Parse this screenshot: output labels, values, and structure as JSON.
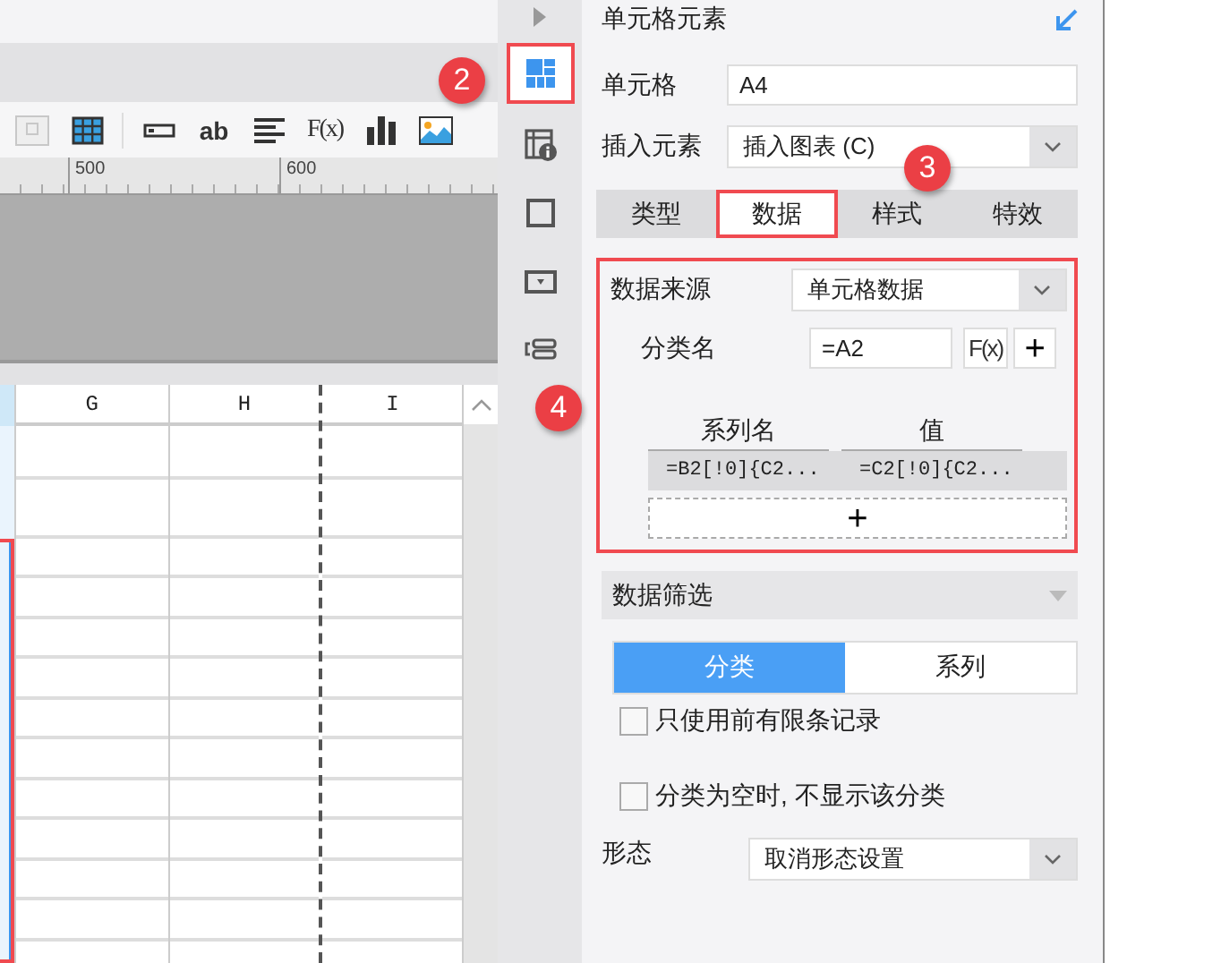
{
  "toolbar": {
    "tools": [
      {
        "kind": "frame",
        "disabled": true
      },
      {
        "kind": "table",
        "disabled": false
      },
      {
        "kind": "textfield",
        "disabled": false
      },
      {
        "kind": "text",
        "label": "ab",
        "disabled": false
      },
      {
        "kind": "align",
        "disabled": false
      },
      {
        "kind": "formula",
        "label": "F(x)",
        "disabled": false
      },
      {
        "kind": "chart",
        "disabled": false
      },
      {
        "kind": "image",
        "disabled": false
      }
    ]
  },
  "ruler": {
    "ticks": [
      "500",
      "600"
    ]
  },
  "sheet": {
    "columns": [
      "G",
      "H",
      "I"
    ]
  },
  "side_icons": [
    {
      "kind": "cell-element",
      "selected": true,
      "highlighted": true
    },
    {
      "kind": "widget-info",
      "selected": false,
      "highlighted": false
    },
    {
      "kind": "frame",
      "selected": false,
      "highlighted": false
    },
    {
      "kind": "dropdown",
      "selected": false,
      "highlighted": false
    },
    {
      "kind": "layout",
      "selected": false,
      "highlighted": false
    }
  ],
  "panel": {
    "title": "单元格元素",
    "cell": {
      "label": "单元格",
      "value": "A4"
    },
    "insert": {
      "label": "插入元素",
      "value": "插入图表 (C)"
    },
    "tabs": [
      {
        "label": "类型",
        "selected": false,
        "highlighted": false
      },
      {
        "label": "数据",
        "selected": true,
        "highlighted": true
      },
      {
        "label": "样式",
        "selected": false,
        "highlighted": false
      },
      {
        "label": "特效",
        "selected": false,
        "highlighted": false
      }
    ],
    "data": {
      "highlighted": true,
      "source": {
        "label": "数据来源",
        "value": "单元格数据"
      },
      "category": {
        "label": "分类名",
        "value": "=A2",
        "formula_button": "F(x)",
        "add_button": "+"
      },
      "series": {
        "columns": [
          "系列名",
          "值"
        ],
        "rows": [
          [
            "=B2[!0]{C2...",
            "=C2[!0]{C2..."
          ]
        ],
        "add_button": "+"
      }
    },
    "filter": {
      "title": "数据筛选",
      "segments": [
        {
          "label": "分类",
          "selected": true
        },
        {
          "label": "系列",
          "selected": false
        }
      ],
      "options": [
        {
          "label": "只使用前有限条记录",
          "checked": false
        },
        {
          "label": "分类为空时, 不显示该分类",
          "checked": false
        }
      ],
      "form": {
        "label": "形态",
        "value": "取消形态设置"
      }
    }
  },
  "annotations": [
    {
      "kind": "icon-strip",
      "label": "2"
    },
    {
      "kind": "tab",
      "label": "3"
    },
    {
      "kind": "data",
      "label": "4"
    }
  ]
}
